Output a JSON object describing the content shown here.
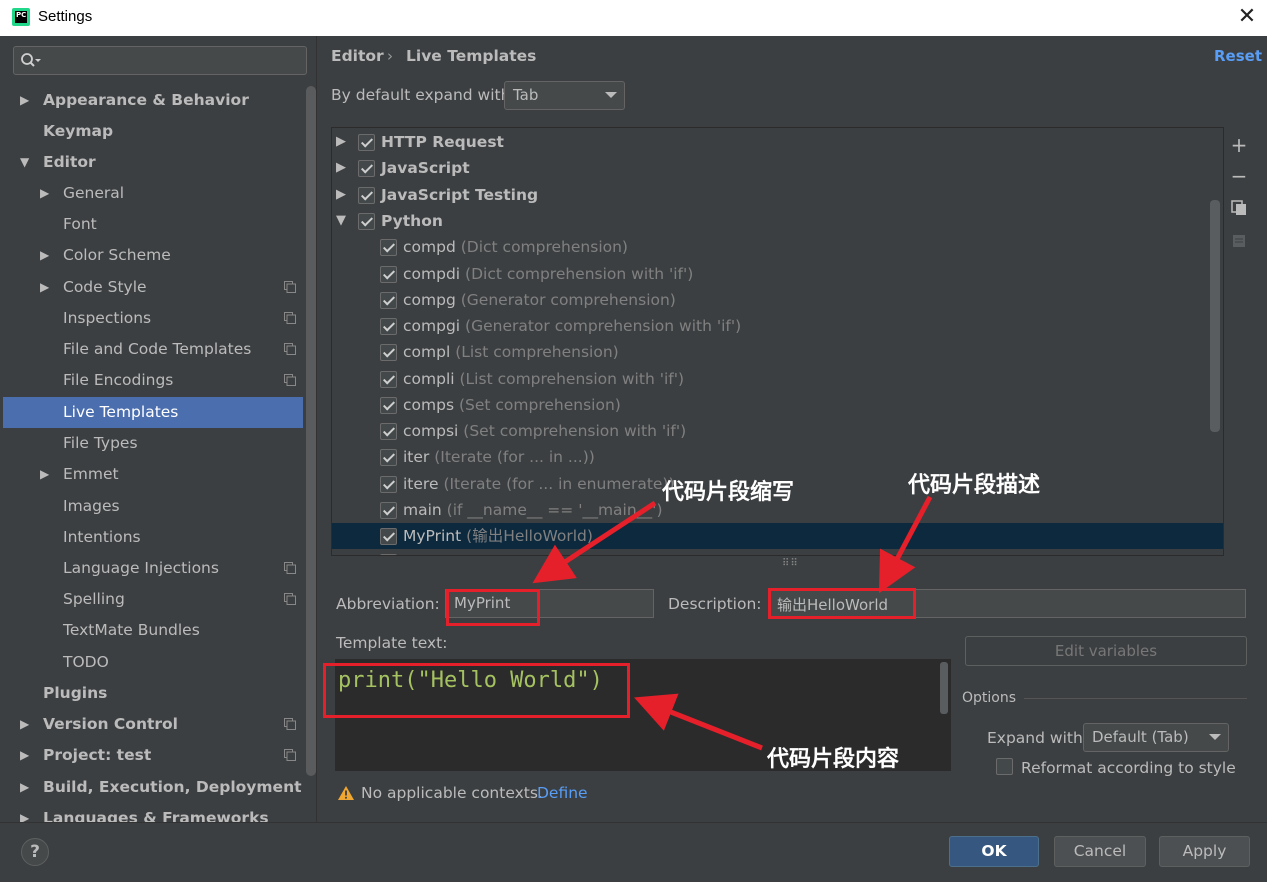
{
  "window": {
    "title": "Settings",
    "icon_text": "PC"
  },
  "sidebar": {
    "search_placeholder": "",
    "items": [
      {
        "label": "Appearance & Behavior"
      },
      {
        "label": "Keymap"
      },
      {
        "label": "Editor"
      },
      {
        "label": "General"
      },
      {
        "label": "Font"
      },
      {
        "label": "Color Scheme"
      },
      {
        "label": "Code Style"
      },
      {
        "label": "Inspections"
      },
      {
        "label": "File and Code Templates"
      },
      {
        "label": "File Encodings"
      },
      {
        "label": "Live Templates"
      },
      {
        "label": "File Types"
      },
      {
        "label": "Emmet"
      },
      {
        "label": "Images"
      },
      {
        "label": "Intentions"
      },
      {
        "label": "Language Injections"
      },
      {
        "label": "Spelling"
      },
      {
        "label": "TextMate Bundles"
      },
      {
        "label": "TODO"
      },
      {
        "label": "Plugins"
      },
      {
        "label": "Version Control"
      },
      {
        "label": "Project: test"
      },
      {
        "label": "Build, Execution, Deployment"
      },
      {
        "label": "Languages & Frameworks"
      }
    ]
  },
  "header": {
    "breadcrumb": [
      "Editor",
      "Live Templates"
    ],
    "breadcrumb_sep": "›",
    "reset_label": "Reset",
    "expand_label": "By default expand with",
    "expand_value": "Tab"
  },
  "templates": {
    "groups": [
      {
        "name": "HTTP Request"
      },
      {
        "name": "JavaScript"
      },
      {
        "name": "JavaScript Testing"
      },
      {
        "name": "Python"
      }
    ],
    "items": [
      {
        "name": "compd",
        "desc": "(Dict comprehension)"
      },
      {
        "name": "compdi",
        "desc": "(Dict comprehension with 'if')"
      },
      {
        "name": "compg",
        "desc": "(Generator comprehension)"
      },
      {
        "name": "compgi",
        "desc": "(Generator comprehension with 'if')"
      },
      {
        "name": "compl",
        "desc": "(List comprehension)"
      },
      {
        "name": "compli",
        "desc": "(List comprehension with 'if')"
      },
      {
        "name": "comps",
        "desc": "(Set comprehension)"
      },
      {
        "name": "compsi",
        "desc": "(Set comprehension with 'if')"
      },
      {
        "name": "iter",
        "desc": "(Iterate (for ... in ...))"
      },
      {
        "name": "itere",
        "desc": "(Iterate (for ... in enumerate))"
      },
      {
        "name": "main",
        "desc": "(if __name__ == '__main__')"
      },
      {
        "name": "MyPrint",
        "desc": "(输出HelloWorld)"
      }
    ]
  },
  "toolbar": {
    "add_icon": "+",
    "remove_icon": "−"
  },
  "fields": {
    "abbreviation_label": "Abbreviation:",
    "abbreviation_value": "MyPrint",
    "description_label": "Description:",
    "description_value": "输出HelloWorld",
    "template_text_label": "Template text:",
    "template_text": "print(\"Hello World\")",
    "edit_variables_label": "Edit variables"
  },
  "options": {
    "title": "Options",
    "expand_with_label": "Expand with",
    "expand_with_value": "Default (Tab)",
    "reformat_label": "Reformat according to style"
  },
  "context": {
    "warning_text": "No applicable contexts.",
    "define_label": "Define"
  },
  "buttons": {
    "help": "?",
    "ok": "OK",
    "cancel": "Cancel",
    "apply": "Apply"
  },
  "annotations": {
    "abbreviation_note": "代码片段缩写",
    "description_note": "代码片段描述",
    "content_note": "代码片段内容"
  },
  "colors": {
    "accent": "#4b6eaf",
    "link": "#589df6",
    "annotation": "#e5202a",
    "selection": "#0d293e"
  }
}
